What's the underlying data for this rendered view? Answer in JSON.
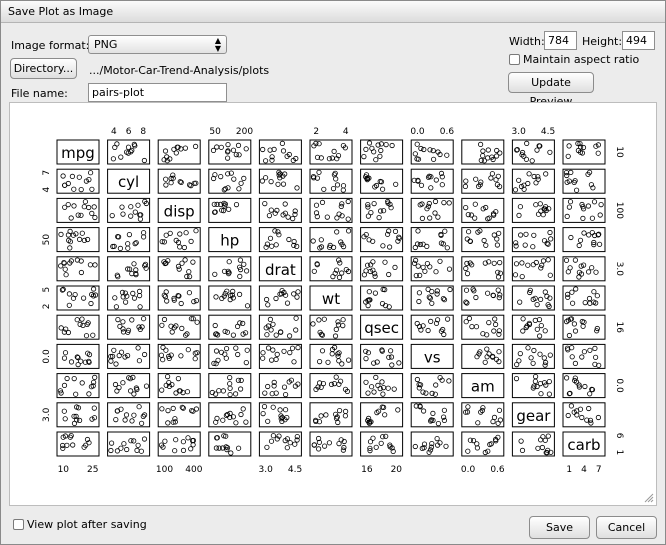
{
  "dialog": {
    "title": "Save Plot as Image"
  },
  "format": {
    "label": "Image format:",
    "value": "PNG"
  },
  "directory": {
    "button": "Directory...",
    "path": ".../Motor-Car-Trend-Analysis/plots"
  },
  "filename": {
    "label": "File name:",
    "value": "pairs-plot"
  },
  "size": {
    "width_label": "Width:",
    "width": "784",
    "height_label": "Height:",
    "height": "494"
  },
  "aspect": {
    "label": "Maintain aspect ratio",
    "checked": false
  },
  "update_preview": "Update Preview",
  "view_after": {
    "label": "View plot after saving",
    "checked": false
  },
  "save": "Save",
  "cancel": "Cancel",
  "chart_data": {
    "type": "scatter",
    "variables": [
      "mpg",
      "cyl",
      "disp",
      "hp",
      "drat",
      "wt",
      "qsec",
      "vs",
      "am",
      "gear",
      "carb"
    ],
    "top_ticks": [
      [],
      [
        "4",
        "6",
        "8"
      ],
      [],
      [
        "50",
        "200"
      ],
      [],
      [
        "2",
        "4"
      ],
      [],
      [
        "0.0",
        "0.6"
      ],
      [],
      [
        "3.0",
        "4.5"
      ],
      []
    ],
    "bottom_ticks": [
      [
        "10",
        "25"
      ],
      [],
      [
        "100",
        "400"
      ],
      [],
      [
        "3.0",
        "4.5"
      ],
      [],
      [
        "16",
        "20"
      ],
      [],
      [
        "0.0",
        "0.6"
      ],
      [],
      [
        "1",
        "4",
        "7"
      ]
    ],
    "left_ticks": [
      [],
      [
        "4",
        "7"
      ],
      [],
      [
        "50"
      ],
      [],
      [
        "2",
        "5"
      ],
      [],
      [
        "0.0"
      ],
      [],
      [
        "3.0"
      ],
      []
    ],
    "right_ticks": [
      [
        "10"
      ],
      [],
      [
        "100"
      ],
      [],
      [
        "3.0"
      ],
      [],
      [
        "16"
      ],
      [],
      [
        "0.0"
      ],
      [],
      [
        "1",
        "6"
      ]
    ]
  }
}
